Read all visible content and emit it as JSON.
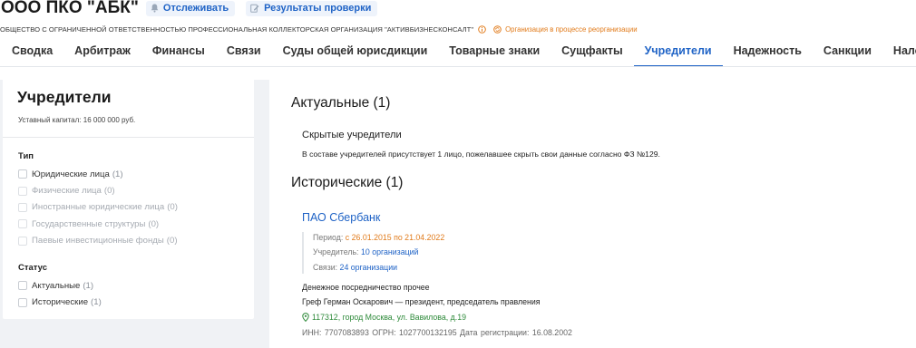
{
  "company": {
    "name": "ООО ПКО \"АБК\"",
    "follow_label": "Отслеживать",
    "check_results_label": "Результаты проверки",
    "full_name": "ОБЩЕСТВО С ОГРАНИЧЕННОЙ ОТВЕТСТВЕННОСТЬЮ ПРОФЕССИОНАЛЬНАЯ КОЛЛЕКТОРСКАЯ ОРГАНИЗАЦИЯ \"АКТИВБИЗНЕСКОНСАЛТ\"",
    "reorg_label": "Организация в процессе реорганизации"
  },
  "tabs": [
    {
      "label": "Сводка",
      "active": false
    },
    {
      "label": "Арбитраж",
      "active": false
    },
    {
      "label": "Финансы",
      "active": false
    },
    {
      "label": "Связи",
      "active": false
    },
    {
      "label": "Суды общей юрисдикции",
      "active": false
    },
    {
      "label": "Товарные знаки",
      "active": false
    },
    {
      "label": "Сущфакты",
      "active": false
    },
    {
      "label": "Учредители",
      "active": true
    },
    {
      "label": "Надежность",
      "active": false
    },
    {
      "label": "Санкции",
      "active": false
    },
    {
      "label": "Налоги",
      "active": false
    }
  ],
  "sidebar": {
    "title": "Учредители",
    "capital": "Уставный капитал: 16 000 000 руб.",
    "type_group": "Тип",
    "type_items": [
      {
        "label": "Юридические лица",
        "count": "(1)",
        "enabled": true
      },
      {
        "label": "Физические лица",
        "count": "(0)",
        "enabled": false
      },
      {
        "label": "Иностранные юридические лица",
        "count": "(0)",
        "enabled": false
      },
      {
        "label": "Государственные структуры",
        "count": "(0)",
        "enabled": false
      },
      {
        "label": "Паевые инвестиционные фонды",
        "count": "(0)",
        "enabled": false
      }
    ],
    "status_group": "Статус",
    "status_items": [
      {
        "label": "Актуальные",
        "count": "(1)",
        "enabled": true
      },
      {
        "label": "Исторические",
        "count": "(1)",
        "enabled": true
      }
    ]
  },
  "main": {
    "actual_heading": "Актуальные (1)",
    "hidden_title": "Скрытые учредители",
    "hidden_desc": "В составе учредителей присутствует 1 лицо, пожелавшее скрыть свои данные согласно ФЗ №129.",
    "historical_heading": "Исторические (1)",
    "org": {
      "name": "ПАО Сбербанк",
      "period_label": "Период:",
      "period_value": "с 26.01.2015 по 21.04.2022",
      "founder_label": "Учредитель:",
      "founder_link": "10 организаций",
      "links_label": "Связи:",
      "links_link": "24 организации",
      "activity": "Денежное посредничество прочее",
      "head": "Греф Герман Оскарович — президент, председатель правления",
      "address": "117312, город Москва, ул. Вавилова, д.19",
      "ids": "ИНН: 7707083893   ОГРН: 1027700132195   Дата регистрации: 16.08.2002"
    }
  },
  "colors": {
    "accent": "#1f63c6",
    "orange": "#e17b1b",
    "green": "#2e8a3a"
  }
}
